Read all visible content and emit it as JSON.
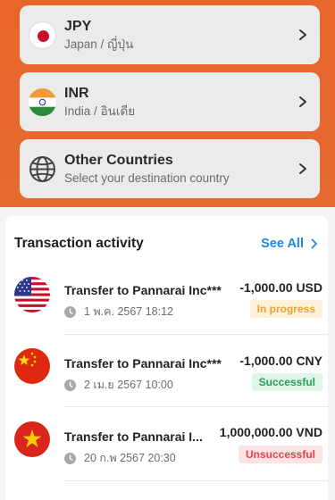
{
  "countries": [
    {
      "code": "JPY",
      "name": "Japan / ญี่ปุ่น",
      "flag_icon": "japan-flag-icon"
    },
    {
      "code": "INR",
      "name": "India / อินเดีย",
      "flag_icon": "india-flag-icon"
    },
    {
      "code": "Other Countries",
      "name": "Select your destination country",
      "flag_icon": "globe-icon"
    }
  ],
  "transactions": {
    "title": "Transaction activity",
    "see_all": "See All",
    "items": [
      {
        "name": "Transfer to Pannarai Inc***",
        "date": "1 พ.ค. 2567 18:12",
        "amount": "-1,000.00 USD",
        "status": "In progress",
        "flag_icon": "usa-flag-icon"
      },
      {
        "name": "Transfer to Pannarai Inc***",
        "date": "2 เม.ย 2567 10:00",
        "amount": "-1,000.00 CNY",
        "status": "Successful",
        "flag_icon": "china-flag-icon"
      },
      {
        "name": "Transfer to Pannarai I...",
        "date": "20 ก.พ 2567 20:30",
        "amount": "1,000,000.00 VND",
        "status": "Unsuccessful",
        "flag_icon": "vietnam-flag-icon"
      }
    ]
  },
  "colors": {
    "brand_orange": "#e8662c",
    "link_blue": "#1e88e5",
    "in_progress": "#e6a233",
    "successful": "#2e9a59",
    "unsuccessful": "#e0434f"
  }
}
